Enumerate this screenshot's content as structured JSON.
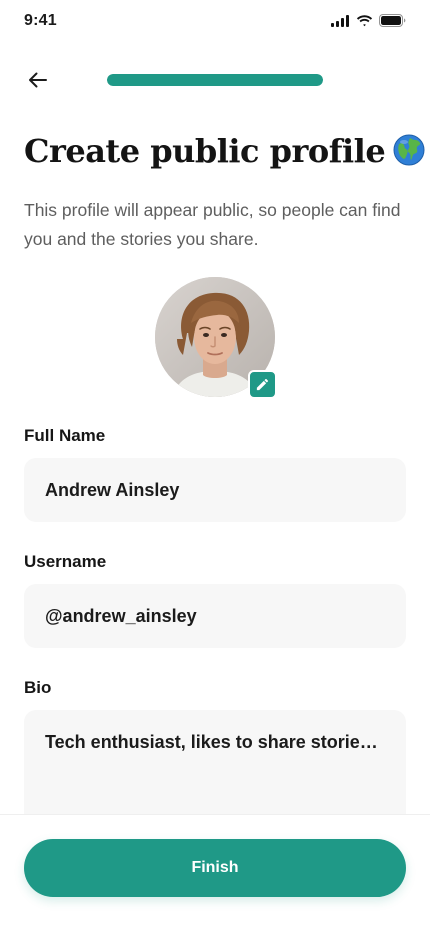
{
  "status_bar": {
    "time": "9:41",
    "icons": [
      "signal-icon",
      "wifi-icon",
      "battery-icon"
    ]
  },
  "header": {
    "back_icon": "arrow-left-icon",
    "progress_fraction": 1.0
  },
  "title": {
    "text": "Create public profile",
    "emoji_icon": "globe-icon"
  },
  "subtitle": "This profile will appear public, so people can find you and the stories you share.",
  "avatar": {
    "edit_icon": "pencil-icon"
  },
  "form": {
    "full_name": {
      "label": "Full Name",
      "value": "Andrew Ainsley"
    },
    "username": {
      "label": "Username",
      "value": "@andrew_ainsley"
    },
    "bio": {
      "label": "Bio",
      "value": "Tech enthusiast, likes to share stories a..."
    }
  },
  "footer": {
    "finish_label": "Finish"
  },
  "colors": {
    "accent": "#1f9987",
    "field_background": "#f7f7f7",
    "text_primary": "#1b1b1b",
    "text_secondary": "#5e5e5e"
  }
}
